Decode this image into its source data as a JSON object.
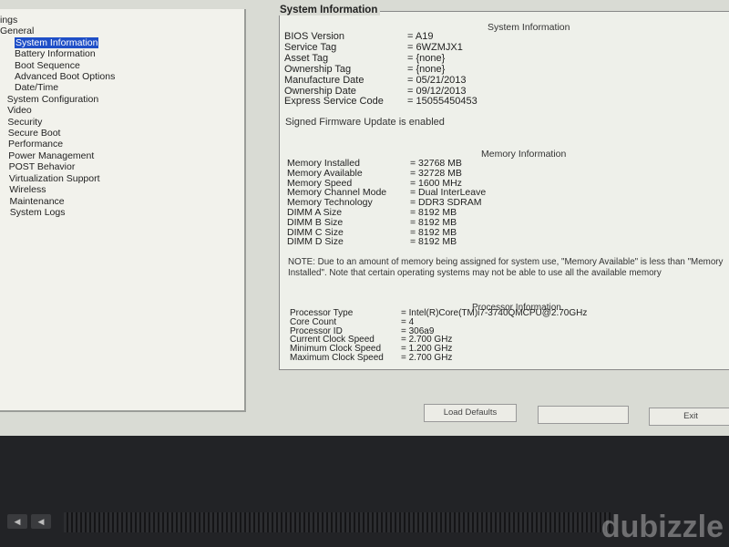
{
  "tree": {
    "root": "ings",
    "items": [
      {
        "label": "General",
        "level": 0
      },
      {
        "label": "System Information",
        "level": 2,
        "selected": true
      },
      {
        "label": "Battery Information",
        "level": 2
      },
      {
        "label": "Boot Sequence",
        "level": 2
      },
      {
        "label": "Advanced Boot Options",
        "level": 2
      },
      {
        "label": "Date/Time",
        "level": 2
      },
      {
        "label": "System Configuration",
        "level": 1
      },
      {
        "label": "Video",
        "level": 1
      },
      {
        "label": "Security",
        "level": 1
      },
      {
        "label": "Secure Boot",
        "level": 1
      },
      {
        "label": "Performance",
        "level": 1
      },
      {
        "label": "Power Management",
        "level": 1
      },
      {
        "label": "POST Behavior",
        "level": 1
      },
      {
        "label": "Virtualization Support",
        "level": 1
      },
      {
        "label": "Wireless",
        "level": 1
      },
      {
        "label": "Maintenance",
        "level": 1
      },
      {
        "label": "System Logs",
        "level": 1
      }
    ]
  },
  "panel": {
    "title": "System Information",
    "system_heading": "System Information",
    "system": [
      [
        "BIOS Version",
        "= A19"
      ],
      [
        "Service Tag",
        "= 6WZMJX1"
      ],
      [
        "Asset Tag",
        "= {none}"
      ],
      [
        "Ownership Tag",
        "= {none}"
      ],
      [
        "Manufacture Date",
        "= 05/21/2013"
      ],
      [
        "Ownership Date",
        "= 09/12/2013"
      ],
      [
        "Express Service Code",
        "= 15055450453"
      ]
    ],
    "firmware": "Signed Firmware Update is enabled",
    "memory_heading": "Memory Information",
    "memory": [
      [
        "Memory Installed",
        "= 32768 MB"
      ],
      [
        "Memory Available",
        "= 32728 MB"
      ],
      [
        "Memory Speed",
        "= 1600 MHz"
      ],
      [
        "Memory Channel Mode",
        "= Dual InterLeave"
      ],
      [
        "Memory Technology",
        "= DDR3 SDRAM"
      ],
      [
        "DIMM A Size",
        "= 8192 MB"
      ],
      [
        "DIMM B Size",
        "= 8192 MB"
      ],
      [
        "DIMM C Size",
        "= 8192 MB"
      ],
      [
        "DIMM D Size",
        "= 8192 MB"
      ]
    ],
    "note": "NOTE: Due to an amount of memory being assigned for system use, \"Memory Available\" is less than \"Memory Installed\". Note that certain operating systems may not be able to use all the available memory",
    "processor_heading": "Processor Information",
    "processor": [
      [
        "Processor Type",
        "= Intel(R)Core(TM)i7-3740QMCPU@2.70GHz"
      ],
      [
        "Core Count",
        "= 4"
      ],
      [
        "Processor ID",
        "= 306a9"
      ],
      [
        "Current Clock Speed",
        "= 2.700 GHz"
      ],
      [
        "Minimum Clock Speed",
        "= 1.200 GHz"
      ],
      [
        "Maximum Clock Speed",
        "= 2.700 GHz"
      ]
    ]
  },
  "buttons": {
    "load_defaults": "Load Defaults",
    "exit": "Exit"
  },
  "watermark": "dubizzle",
  "colors": {
    "selection": "#1f4fc7"
  }
}
